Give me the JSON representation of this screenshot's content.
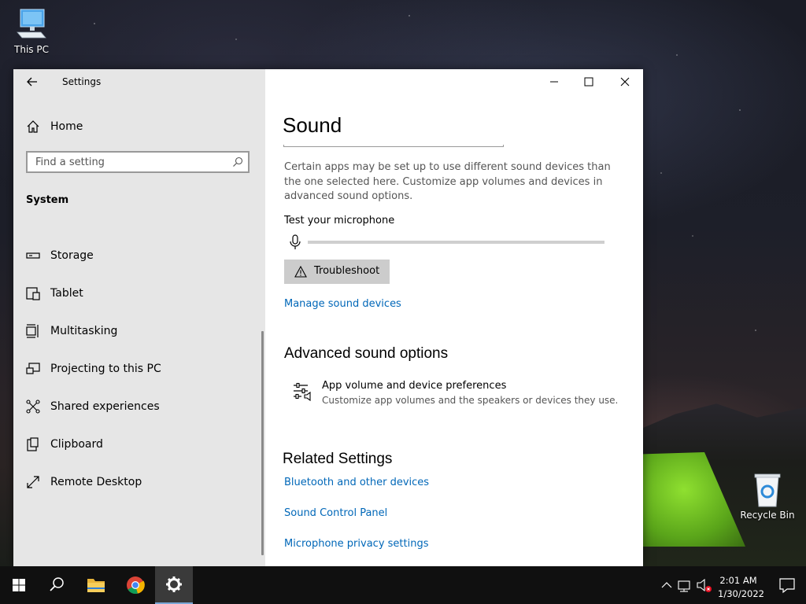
{
  "desktop": {
    "icons": [
      {
        "label": "This PC"
      },
      {
        "label": "Recycle Bin"
      }
    ]
  },
  "window": {
    "title": "Settings",
    "controls": {
      "minimize": "minimize-icon",
      "maximize": "maximize-icon",
      "close": "close-icon"
    }
  },
  "sidebar": {
    "home_label": "Home",
    "search_placeholder": "Find a setting",
    "section_heading": "System",
    "items": [
      {
        "label": "Storage",
        "icon": "storage-icon"
      },
      {
        "label": "Tablet",
        "icon": "tablet-icon"
      },
      {
        "label": "Multitasking",
        "icon": "multitasking-icon"
      },
      {
        "label": "Projecting to this PC",
        "icon": "projecting-icon"
      },
      {
        "label": "Shared experiences",
        "icon": "shared-experiences-icon"
      },
      {
        "label": "Clipboard",
        "icon": "clipboard-icon"
      },
      {
        "label": "Remote Desktop",
        "icon": "remote-desktop-icon"
      }
    ]
  },
  "content": {
    "page_title": "Sound",
    "description": "Certain apps may be set up to use different sound devices than the one selected here. Customize app volumes and devices in advanced sound options.",
    "mic_label": "Test your microphone",
    "mic_level": 0,
    "troubleshoot_label": "Troubleshoot",
    "manage_link": "Manage sound devices",
    "advanced_heading": "Advanced sound options",
    "pref_title": "App volume and device preferences",
    "pref_subtitle": "Customize app volumes and the speakers or devices they use.",
    "related_heading": "Related Settings",
    "related_links": [
      "Bluetooth and other devices",
      "Sound Control Panel",
      "Microphone privacy settings"
    ]
  },
  "taskbar": {
    "time": "2:01 AM",
    "date": "1/30/2022",
    "colors": {
      "accent": "#0067b8",
      "active_underline": "#7aa7d6"
    }
  }
}
